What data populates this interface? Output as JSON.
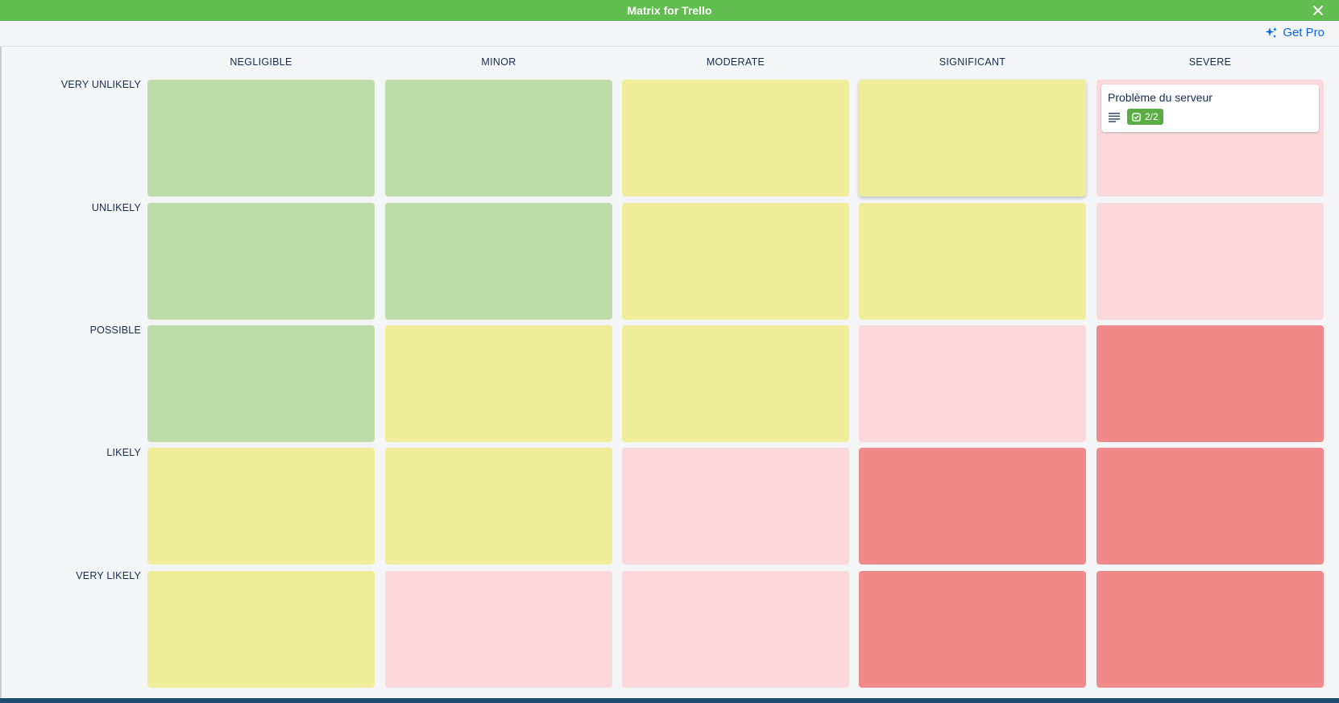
{
  "window": {
    "title": "Matrix for Trello"
  },
  "toolbar": {
    "get_pro_label": "Get Pro"
  },
  "matrix": {
    "columns": [
      "NEGLIGIBLE",
      "MINOR",
      "MODERATE",
      "SIGNIFICANT",
      "SEVERE"
    ],
    "rows": [
      "VERY UNLIKELY",
      "UNLIKELY",
      "POSSIBLE",
      "LIKELY",
      "VERY LIKELY"
    ],
    "cell_colors": {
      "green": "#bcdca8",
      "yellow": "#f0ed9a",
      "pink": "#fad8dc",
      "red": "#f08a8a"
    },
    "grid": [
      [
        "green",
        "green",
        "yellow",
        "yellow",
        "pink"
      ],
      [
        "green",
        "green",
        "yellow",
        "yellow",
        "pink"
      ],
      [
        "green",
        "yellow",
        "yellow",
        "pink",
        "red"
      ],
      [
        "yellow",
        "yellow",
        "pink",
        "red",
        "red"
      ],
      [
        "yellow",
        "pink",
        "pink",
        "red",
        "red"
      ]
    ]
  },
  "card": {
    "title": "Problème du serveur",
    "checklist": "2/2",
    "icons": [
      "description-icon",
      "checklist-icon"
    ]
  },
  "colors": {
    "header_green": "#61bd4f",
    "link_blue": "#0c66e4",
    "badge_green": "#5aac44"
  }
}
